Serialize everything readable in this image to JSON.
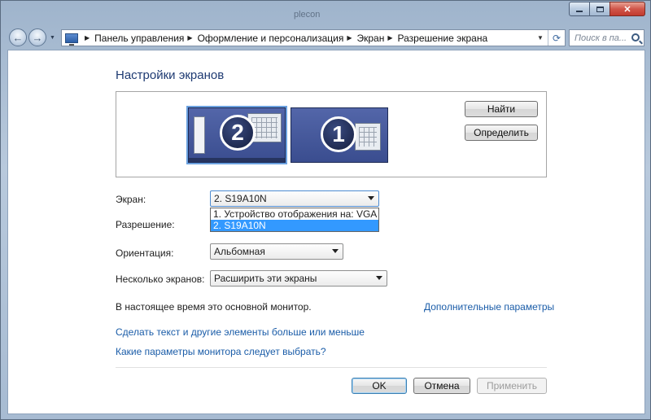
{
  "window": {
    "title": "plecon"
  },
  "titlebar": {
    "minimize_icon": "minimize-icon",
    "maximize_icon": "maximize-icon",
    "close_icon": "close-icon"
  },
  "nav": {
    "back_icon": "arrow-left-icon",
    "forward_icon": "arrow-right-icon",
    "breadcrumbs": [
      "Панель управления",
      "Оформление и персонализация",
      "Экран",
      "Разрешение экрана"
    ],
    "search_placeholder": "Поиск в па..."
  },
  "main": {
    "heading": "Настройки экранов",
    "monitors": [
      {
        "number": "2",
        "selected": true
      },
      {
        "number": "1",
        "selected": false
      }
    ],
    "find_button": "Найти",
    "identify_button": "Определить",
    "display_label": "Экран:",
    "display_value": "2. S19A10N",
    "display_options": [
      "1. Устройство отображения на: VGA",
      "2. S19A10N"
    ],
    "display_options_selected": "2. S19A10N",
    "resolution_label": "Разрешение:",
    "orientation_label": "Ориентация:",
    "orientation_value": "Альбомная",
    "multiple_label": "Несколько экранов:",
    "multiple_value": "Расширить эти экраны",
    "status_text": "В настоящее время это основной монитор.",
    "advanced_link": "Дополнительные параметры",
    "text_size_link": "Сделать текст и другие элементы больше или меньше",
    "which_settings_link": "Какие параметры монитора следует выбрать?"
  },
  "footer": {
    "ok": "OK",
    "cancel": "Отмена",
    "apply": "Применить"
  },
  "colors": {
    "heading": "#1e3a72",
    "link": "#1a5ca8",
    "selection": "#3399ff",
    "monitor": "#3a4d8f"
  }
}
